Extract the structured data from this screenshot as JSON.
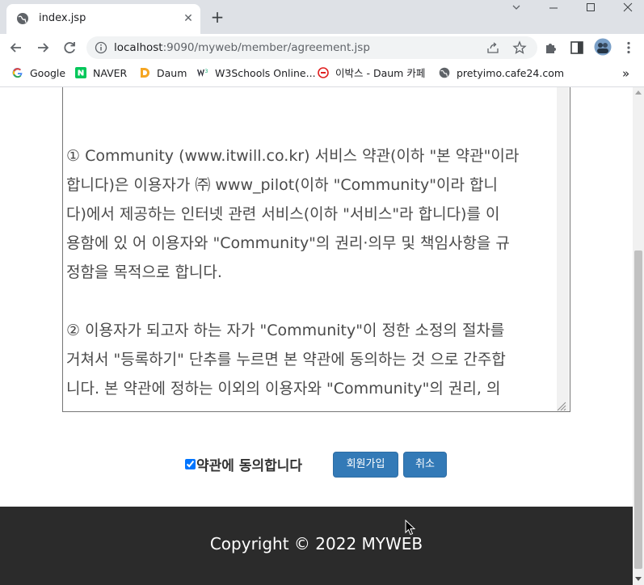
{
  "browser": {
    "tab": {
      "title": "index.jsp"
    },
    "address": {
      "host": "localhost",
      "rest": ":9090/myweb/member/agreement.jsp"
    },
    "bookmarks": [
      {
        "label": "Google",
        "icon": "google-icon",
        "color": "#4285f4"
      },
      {
        "label": "NAVER",
        "icon": "naver-icon",
        "color": "#03c75a"
      },
      {
        "label": "Daum",
        "icon": "daum-icon",
        "color": "#f5a623"
      },
      {
        "label": "W3Schools Online...",
        "icon": "w3schools-icon",
        "color": "#04aa6d"
      },
      {
        "label": "이박스 - Daum 카페",
        "icon": "cafe-icon",
        "color": "#e02020"
      },
      {
        "label": "pretyimo.cafe24.com",
        "icon": "globe-icon",
        "color": "#5f6368"
      }
    ]
  },
  "page": {
    "terms_text": "① Community (www.itwill.co.kr) 서비스 약관(이하 \"본 약관\"이라\n합니다)은 이용자가 ㈜ www_pilot(이하 \"Community\"이라 합니\n다)에서 제공하는 인터넷 관련 서비스(이하 \"서비스\"라 합니다)를 이\n용함에 있 어 이용자와 \"Community\"의 권리·의무 및 책임사항을 규\n정함을 목적으로 합니다.\n\n② 이용자가 되고자 하는 자가 \"Community\"이 정한 소정의 절차를\n거쳐서 \"등록하기\" 단추를 누르면 본 약관에 동의하는 것 으로 간주합\n니다. 본 약관에 정하는 이외의 이용자와 \"Community\"의 권리, 의",
    "agree_label": "약관에 동의합니다",
    "agree_checked": true,
    "join_button": "회원가입",
    "cancel_button": "취소",
    "footer": "Copyright © 2022 MYWEB"
  },
  "colors": {
    "primary_button": "#337ab7",
    "footer_bg": "#2b2b2b"
  }
}
